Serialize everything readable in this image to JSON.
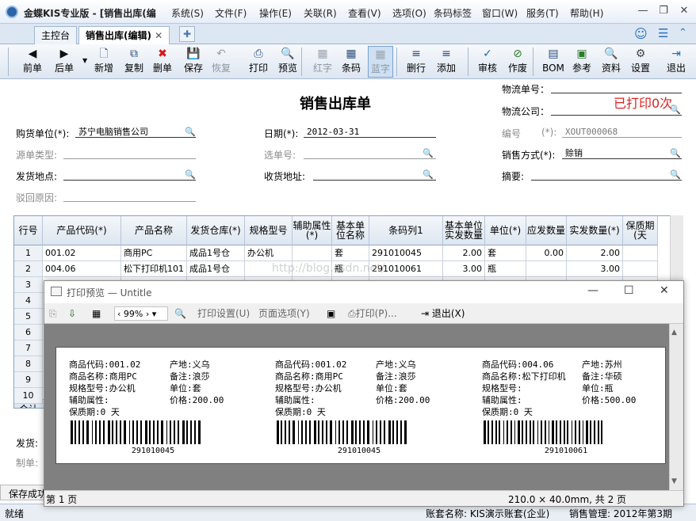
{
  "window": {
    "title": "金蝶KIS专业版 - [销售出库(编",
    "menus": [
      "系统(S)",
      "文件(F)",
      "操作(E)",
      "关联(R)",
      "查看(V)",
      "选项(O)",
      "条码标签",
      "窗口(W)",
      "服务(T)",
      "帮助(H)"
    ]
  },
  "tabs": [
    "主控台",
    "销售出库(编辑)"
  ],
  "toolbar": [
    {
      "label": "前单",
      "icon": "arrow-left-icon",
      "glyph": "◀",
      "disabled": false
    },
    {
      "label": "后单",
      "icon": "arrow-right-icon",
      "glyph": "▶",
      "disabled": false
    },
    {
      "label": "新增",
      "icon": "new-doc-icon",
      "glyph": "🗋",
      "disabled": false
    },
    {
      "label": "复制",
      "icon": "copy-icon",
      "glyph": "⧉",
      "disabled": false
    },
    {
      "label": "删单",
      "icon": "delete-icon",
      "glyph": "✖",
      "disabled": false
    },
    {
      "label": "保存",
      "icon": "save-icon",
      "glyph": "💾",
      "disabled": false
    },
    {
      "label": "恢复",
      "icon": "undo-icon",
      "glyph": "↶",
      "disabled": true
    },
    {
      "label": "打印",
      "icon": "print-icon",
      "glyph": "⎙",
      "disabled": false
    },
    {
      "label": "预览",
      "icon": "preview-icon",
      "glyph": "🔍",
      "disabled": false
    },
    {
      "label": "红字",
      "icon": "grid-icon",
      "glyph": "▦",
      "disabled": true
    },
    {
      "label": "条码",
      "icon": "grid-icon",
      "glyph": "▦",
      "disabled": false
    },
    {
      "label": "蓝字",
      "icon": "grid-icon",
      "glyph": "▦",
      "disabled": true
    },
    {
      "label": "删行",
      "icon": "delete-row-icon",
      "glyph": "≡",
      "disabled": false
    },
    {
      "label": "添加",
      "icon": "add-row-icon",
      "glyph": "≡",
      "disabled": false
    },
    {
      "label": "审核",
      "icon": "audit-icon",
      "glyph": "✓",
      "disabled": false
    },
    {
      "label": "作废",
      "icon": "void-icon",
      "glyph": "⊘",
      "disabled": false
    },
    {
      "label": "BOM",
      "icon": "bom-icon",
      "glyph": "▤",
      "disabled": false
    },
    {
      "label": "参考",
      "icon": "reference-icon",
      "glyph": "▣",
      "disabled": false
    },
    {
      "label": "资料",
      "icon": "data-icon",
      "glyph": "🔍",
      "disabled": false
    },
    {
      "label": "设置",
      "icon": "settings-icon",
      "glyph": "⚙",
      "disabled": false
    },
    {
      "label": "退出",
      "icon": "exit-icon",
      "glyph": "⇥",
      "disabled": false
    }
  ],
  "form": {
    "title": "销售出库单",
    "printed": "已打印0次",
    "logistics_no_label": "物流单号：",
    "logistics_co_label": "物流公司：",
    "buyer_label": "购货单位(*):",
    "buyer_value": "苏宁电脑销售公司",
    "date_label": "日期(*):",
    "date_value": "2012-03-31",
    "code_label": "编号",
    "code_req": "(*):",
    "code_value": "XOUT000068",
    "source_type_label": "源单类型:",
    "select_no_label": "选单号:",
    "sale_mode_label": "销售方式(*):",
    "sale_mode_value": "赊销",
    "ship_place_label": "发货地点:",
    "receive_addr_label": "收货地址:",
    "summary_label": "摘要:",
    "reject_reason_label": "驳回原因:"
  },
  "grid": {
    "columns": [
      "行号",
      "产品代码(*)",
      "产品名称",
      "发货仓库(*)",
      "规格型号",
      "辅助属性(*)",
      "基本单位名称",
      "条码列1",
      "基本单位实发数量",
      "单位(*)",
      "应发数量",
      "实发数量(*)",
      "保质期(天"
    ],
    "rows": [
      [
        "1",
        "001.02",
        "商用PC",
        "成品1号仓",
        "办公机",
        "",
        "套",
        "291010045",
        "2.00",
        "套",
        "0.00",
        "2.00",
        ""
      ],
      [
        "2",
        "004.06",
        "松下打印机101",
        "成品1号仓",
        "",
        "",
        "瓶",
        "291010061",
        "3.00",
        "瓶",
        "",
        "3.00",
        ""
      ],
      [
        "3",
        "",
        "",
        "",
        "",
        "",
        "",
        "",
        "",
        "",
        "",
        "",
        ""
      ],
      [
        "4",
        "",
        "",
        "",
        "",
        "",
        "",
        "",
        "",
        "",
        "",
        "",
        ""
      ],
      [
        "5",
        "",
        "",
        "",
        "",
        "",
        "",
        "",
        "",
        "",
        "",
        "",
        ""
      ],
      [
        "6",
        "",
        "",
        "",
        "",
        "",
        "",
        "",
        "",
        "",
        "",
        "",
        ""
      ],
      [
        "7",
        "",
        "",
        "",
        "",
        "",
        "",
        "",
        "",
        "",
        "",
        "",
        ""
      ],
      [
        "8",
        "",
        "",
        "",
        "",
        "",
        "",
        "",
        "",
        "",
        "",
        "",
        ""
      ],
      [
        "9",
        "",
        "",
        "",
        "",
        "",
        "",
        "",
        "",
        "",
        "",
        "",
        ""
      ],
      [
        "10",
        "",
        "",
        "",
        "",
        "",
        "",
        "",
        "",
        "",
        "",
        "",
        ""
      ]
    ],
    "sum_label": "合计"
  },
  "footer": {
    "ship_label": "发货:",
    "maker_label": "制单:",
    "save_status": "保存成功"
  },
  "watermark": "http://blog.csdn.net/",
  "status": {
    "ready": "就绪",
    "account": "账套名称: KIS演示账套(企业)",
    "period": "销售管理: 2012年第3期"
  },
  "preview": {
    "title": "打印预览 — Untitle",
    "zoom": "99%",
    "print_setup": "打印设置(U)",
    "page_options": "页面选项(Y)",
    "print": "打印(P)...",
    "exit": "退出(X)",
    "page": "第 1 页",
    "paper_info": "210.0 × 40.0mm, 共 2 页",
    "labels": [
      {
        "code_l": "商品代码:",
        "code": "001.02",
        "origin_l": "产地:",
        "origin": "义乌",
        "name_l": "商品名称:",
        "name": "商用PC",
        "note_l": "备注:",
        "note": "浪莎",
        "spec_l": "规格型号:",
        "spec": "办公机",
        "unit_l": "单位:",
        "unit": "套",
        "aux_l": "辅助属性:",
        "price_l": "价格:",
        "price": "200.00",
        "shelf_l": "保质期:",
        "shelf": "0 天",
        "barcode": "291010045"
      },
      {
        "code_l": "商品代码:",
        "code": "001.02",
        "origin_l": "产地:",
        "origin": "义乌",
        "name_l": "商品名称:",
        "name": "商用PC",
        "note_l": "备注:",
        "note": "浪莎",
        "spec_l": "规格型号:",
        "spec": "办公机",
        "unit_l": "单位:",
        "unit": "套",
        "aux_l": "辅助属性:",
        "price_l": "价格:",
        "price": "200.00",
        "shelf_l": "保质期:",
        "shelf": "0 天",
        "barcode": "291010045"
      },
      {
        "code_l": "商品代码:",
        "code": "004.06",
        "origin_l": "产地:",
        "origin": "苏州",
        "name_l": "商品名称:",
        "name": "松下打印机",
        "note_l": "备注:",
        "note": "华硕",
        "spec_l": "规格型号:",
        "spec": "",
        "unit_l": "单位:",
        "unit": "瓶",
        "aux_l": "辅助属性:",
        "price_l": "价格:",
        "price": "500.00",
        "shelf_l": "保质期:",
        "shelf": "0 天",
        "barcode": "291010061"
      }
    ]
  },
  "colors": {
    "accent": "#2e63a8",
    "printed": "#e02020",
    "header": "#dde6f0"
  }
}
